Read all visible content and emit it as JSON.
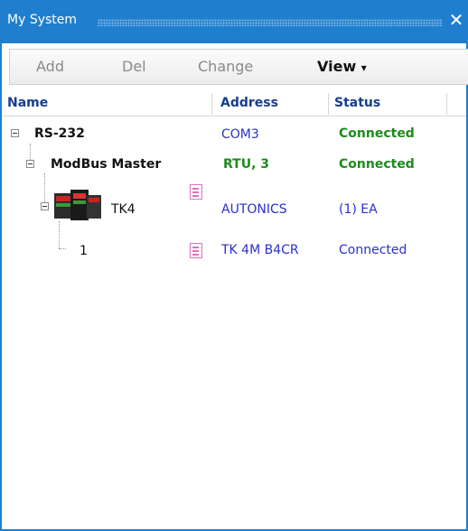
{
  "window": {
    "title": "My System",
    "close_glyph": "✕"
  },
  "toolbar": {
    "add": "Add",
    "del": "Del",
    "change": "Change",
    "view": "View",
    "view_arrow": "▾"
  },
  "columns": {
    "name": "Name",
    "address": "Address",
    "status": "Status"
  },
  "rows": [
    {
      "name": "RS-232",
      "address": "COM3",
      "status": "Connected",
      "icon": "minus-box-icon"
    },
    {
      "name": "ModBus Master",
      "address": "RTU, 3",
      "status": "Connected",
      "icon": "minus-box-icon"
    },
    {
      "name": "TK4",
      "address": "AUTONICS",
      "status": "(1) EA",
      "icon": "device-icon"
    },
    {
      "name": "1",
      "address": "TK 4M B4CR",
      "status": "Connected",
      "icon": "document-icon"
    }
  ],
  "colors": {
    "title_bar": "#1f7fce",
    "header_text": "#163e8c",
    "connected_green": "#1e8a1e",
    "link_blue": "#2a32c8",
    "doc_pink": "#e070c0"
  }
}
